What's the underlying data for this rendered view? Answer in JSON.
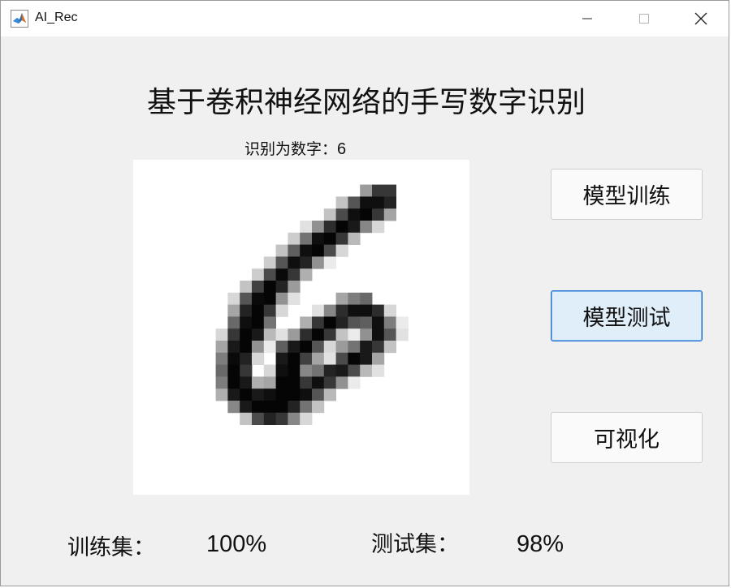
{
  "window": {
    "title": "AI_Rec"
  },
  "main": {
    "heading": "基于卷积神经网络的手写数字识别",
    "result_label": "识别为数字：",
    "result_value": "6"
  },
  "buttons": {
    "train": "模型训练",
    "test": "模型测试",
    "visualize": "可视化"
  },
  "stats": {
    "train_label": "训练集：",
    "train_value": "100%",
    "test_label": "测试集：",
    "test_value": "98%"
  },
  "digit_image": {
    "grid_size": 28,
    "pixels": [
      [
        19,
        9,
        100
      ],
      [
        20,
        9,
        200
      ],
      [
        21,
        9,
        200
      ],
      [
        17,
        10,
        60
      ],
      [
        18,
        10,
        170
      ],
      [
        19,
        10,
        240
      ],
      [
        20,
        10,
        240
      ],
      [
        21,
        10,
        220
      ],
      [
        16,
        11,
        60
      ],
      [
        17,
        11,
        180
      ],
      [
        18,
        11,
        240
      ],
      [
        19,
        11,
        250
      ],
      [
        20,
        11,
        200
      ],
      [
        21,
        11,
        90
      ],
      [
        14,
        12,
        30
      ],
      [
        15,
        12,
        110
      ],
      [
        16,
        12,
        210
      ],
      [
        17,
        12,
        250
      ],
      [
        18,
        12,
        230
      ],
      [
        19,
        12,
        120
      ],
      [
        20,
        12,
        40
      ],
      [
        13,
        13,
        50
      ],
      [
        14,
        13,
        140
      ],
      [
        15,
        13,
        240
      ],
      [
        16,
        13,
        250
      ],
      [
        17,
        13,
        200
      ],
      [
        18,
        13,
        70
      ],
      [
        12,
        14,
        60
      ],
      [
        13,
        14,
        160
      ],
      [
        14,
        14,
        240
      ],
      [
        15,
        14,
        250
      ],
      [
        16,
        14,
        180
      ],
      [
        17,
        14,
        40
      ],
      [
        11,
        15,
        50
      ],
      [
        12,
        15,
        170
      ],
      [
        13,
        15,
        240
      ],
      [
        14,
        15,
        220
      ],
      [
        15,
        15,
        110
      ],
      [
        16,
        15,
        20
      ],
      [
        10,
        16,
        50
      ],
      [
        11,
        16,
        180
      ],
      [
        12,
        16,
        245
      ],
      [
        13,
        16,
        200
      ],
      [
        14,
        16,
        80
      ],
      [
        9,
        17,
        60
      ],
      [
        10,
        17,
        190
      ],
      [
        11,
        17,
        250
      ],
      [
        12,
        17,
        220
      ],
      [
        13,
        17,
        100
      ],
      [
        8,
        18,
        40
      ],
      [
        9,
        18,
        170
      ],
      [
        10,
        18,
        245
      ],
      [
        11,
        18,
        250
      ],
      [
        12,
        18,
        110
      ],
      [
        13,
        18,
        30
      ],
      [
        17,
        18,
        90
      ],
      [
        18,
        18,
        130
      ],
      [
        19,
        18,
        150
      ],
      [
        8,
        19,
        90
      ],
      [
        9,
        19,
        220
      ],
      [
        10,
        19,
        250
      ],
      [
        11,
        19,
        200
      ],
      [
        12,
        19,
        40
      ],
      [
        15,
        19,
        30
      ],
      [
        16,
        19,
        120
      ],
      [
        17,
        19,
        210
      ],
      [
        18,
        19,
        240
      ],
      [
        19,
        19,
        240
      ],
      [
        20,
        19,
        210
      ],
      [
        21,
        19,
        40
      ],
      [
        8,
        20,
        150
      ],
      [
        9,
        20,
        240
      ],
      [
        10,
        20,
        250
      ],
      [
        11,
        20,
        140
      ],
      [
        14,
        20,
        80
      ],
      [
        15,
        20,
        200
      ],
      [
        16,
        20,
        250
      ],
      [
        17,
        20,
        220
      ],
      [
        18,
        20,
        170
      ],
      [
        19,
        20,
        160
      ],
      [
        20,
        20,
        240
      ],
      [
        21,
        20,
        130
      ],
      [
        22,
        20,
        20
      ],
      [
        7,
        21,
        40
      ],
      [
        8,
        21,
        200
      ],
      [
        9,
        21,
        250
      ],
      [
        10,
        21,
        230
      ],
      [
        11,
        21,
        70
      ],
      [
        12,
        21,
        30
      ],
      [
        13,
        21,
        100
      ],
      [
        14,
        21,
        210
      ],
      [
        15,
        21,
        250
      ],
      [
        16,
        21,
        200
      ],
      [
        17,
        21,
        60
      ],
      [
        18,
        21,
        20
      ],
      [
        19,
        21,
        110
      ],
      [
        20,
        21,
        240
      ],
      [
        21,
        21,
        170
      ],
      [
        22,
        21,
        30
      ],
      [
        7,
        22,
        90
      ],
      [
        8,
        22,
        230
      ],
      [
        9,
        22,
        250
      ],
      [
        10,
        22,
        110
      ],
      [
        11,
        22,
        20
      ],
      [
        12,
        22,
        160
      ],
      [
        13,
        22,
        230
      ],
      [
        14,
        22,
        250
      ],
      [
        15,
        22,
        170
      ],
      [
        16,
        22,
        40
      ],
      [
        17,
        22,
        100
      ],
      [
        18,
        22,
        140
      ],
      [
        19,
        22,
        230
      ],
      [
        20,
        22,
        200
      ],
      [
        21,
        22,
        60
      ],
      [
        7,
        23,
        130
      ],
      [
        8,
        23,
        245
      ],
      [
        9,
        23,
        220
      ],
      [
        10,
        23,
        40
      ],
      [
        12,
        23,
        230
      ],
      [
        13,
        23,
        250
      ],
      [
        14,
        23,
        190
      ],
      [
        15,
        23,
        90
      ],
      [
        16,
        23,
        30
      ],
      [
        17,
        23,
        180
      ],
      [
        18,
        23,
        250
      ],
      [
        19,
        23,
        230
      ],
      [
        20,
        23,
        90
      ],
      [
        7,
        24,
        150
      ],
      [
        8,
        24,
        250
      ],
      [
        9,
        24,
        200
      ],
      [
        11,
        24,
        40
      ],
      [
        12,
        24,
        240
      ],
      [
        13,
        24,
        250
      ],
      [
        14,
        24,
        120
      ],
      [
        15,
        24,
        140
      ],
      [
        16,
        24,
        220
      ],
      [
        17,
        24,
        230
      ],
      [
        18,
        24,
        180
      ],
      [
        19,
        24,
        70
      ],
      [
        20,
        24,
        30
      ],
      [
        7,
        25,
        130
      ],
      [
        8,
        25,
        250
      ],
      [
        9,
        25,
        230
      ],
      [
        10,
        25,
        80
      ],
      [
        11,
        25,
        90
      ],
      [
        12,
        25,
        250
      ],
      [
        13,
        25,
        250
      ],
      [
        14,
        25,
        200
      ],
      [
        15,
        25,
        240
      ],
      [
        16,
        25,
        200
      ],
      [
        17,
        25,
        110
      ],
      [
        18,
        25,
        20
      ],
      [
        7,
        26,
        80
      ],
      [
        8,
        26,
        230
      ],
      [
        9,
        26,
        250
      ],
      [
        10,
        26,
        230
      ],
      [
        11,
        26,
        240
      ],
      [
        12,
        26,
        250
      ],
      [
        13,
        26,
        250
      ],
      [
        14,
        26,
        240
      ],
      [
        15,
        26,
        170
      ],
      [
        16,
        26,
        70
      ],
      [
        8,
        27,
        120
      ],
      [
        9,
        27,
        230
      ],
      [
        10,
        27,
        250
      ],
      [
        11,
        27,
        250
      ],
      [
        12,
        27,
        250
      ],
      [
        13,
        27,
        220
      ],
      [
        14,
        27,
        140
      ],
      [
        15,
        27,
        60
      ],
      [
        9,
        28,
        60
      ],
      [
        10,
        28,
        180
      ],
      [
        11,
        28,
        220
      ],
      [
        12,
        28,
        200
      ],
      [
        13,
        28,
        120
      ],
      [
        14,
        28,
        40
      ]
    ]
  }
}
